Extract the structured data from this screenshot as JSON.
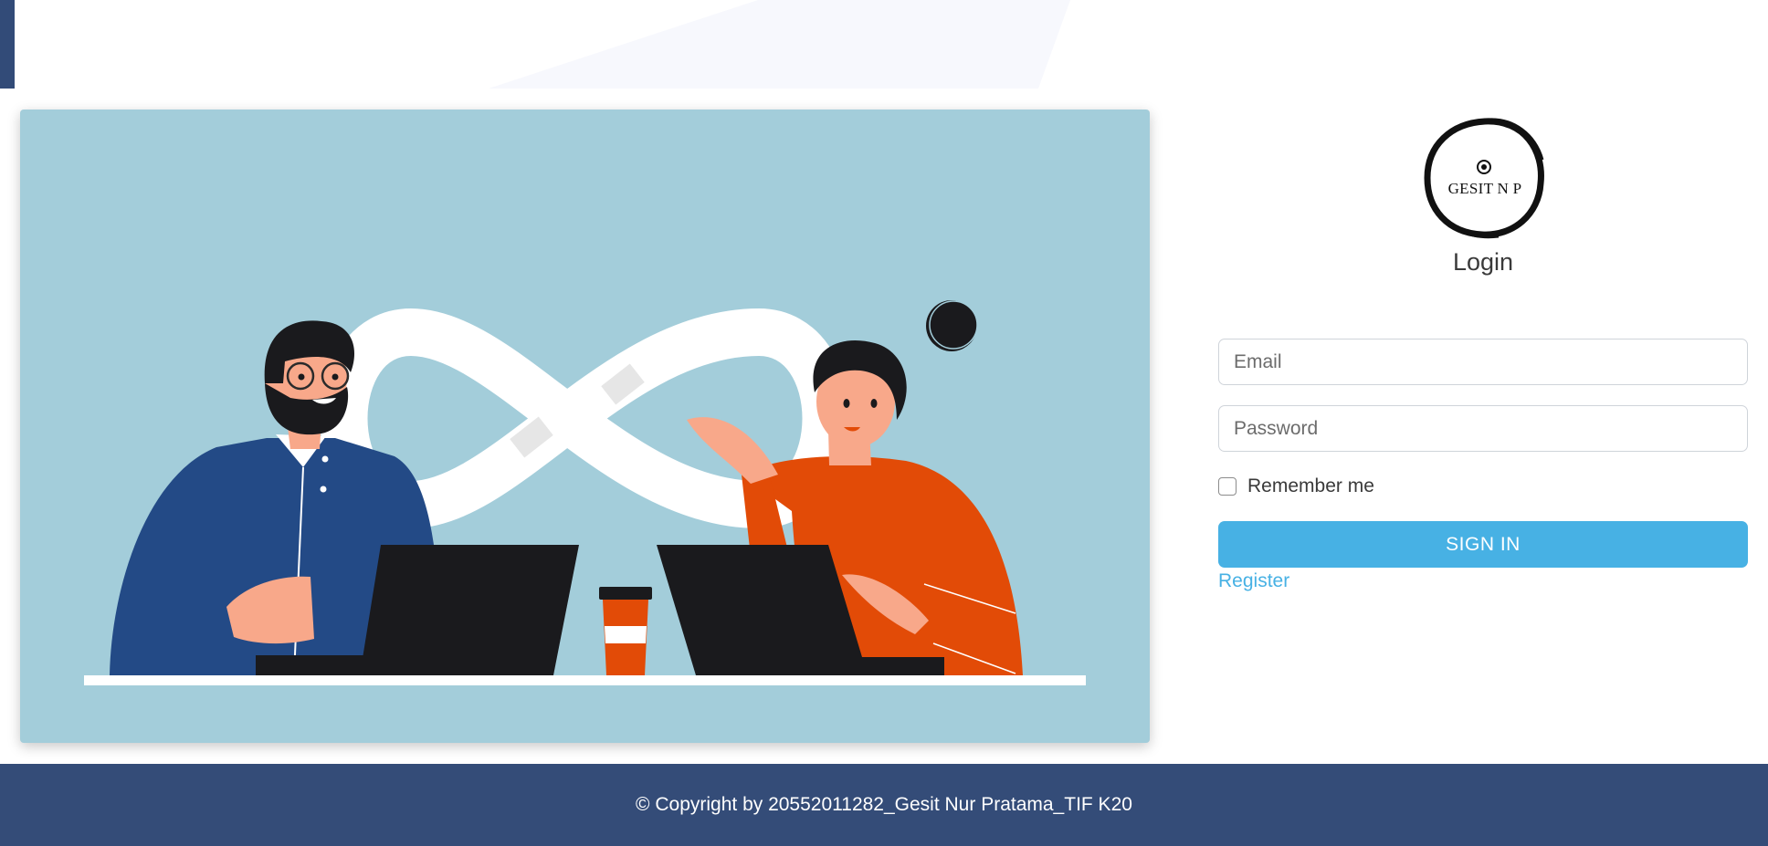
{
  "login": {
    "logo_text": "GESIT N P",
    "title": "Login",
    "email_placeholder": "Email",
    "password_placeholder": "Password",
    "remember_label": "Remember me",
    "remember_checked": false,
    "signin_label": "SIGN IN",
    "register_label": "Register"
  },
  "footer": {
    "copyright": "© Copyright by 20552011282_Gesit Nur Pratama_TIF K20"
  },
  "colors": {
    "primary_button": "#47b1e4",
    "footer_bg": "#344c78",
    "hero_bg": "#a3cdda",
    "accent_orange": "#e24b07",
    "accent_blue": "#234a86"
  }
}
